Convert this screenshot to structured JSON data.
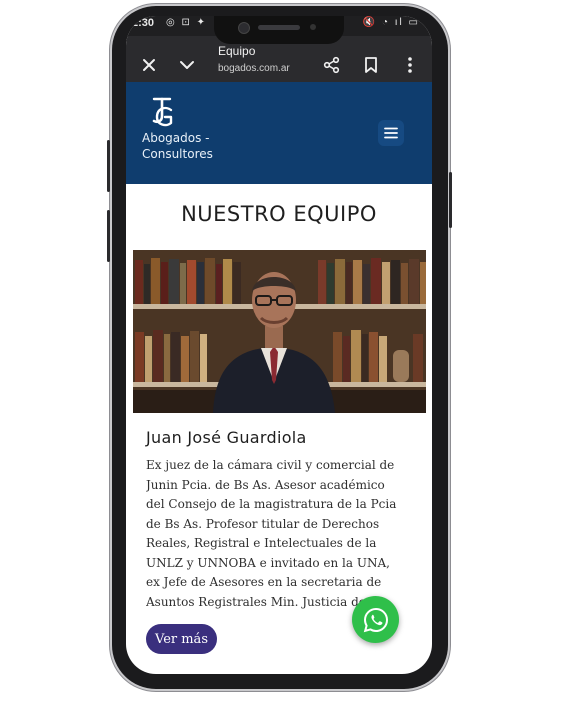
{
  "status_bar": {
    "time": "2:30",
    "left_icons": "◎ ⊡ ✦",
    "right_icons": "🔇 ◔ ıl ▭"
  },
  "browser": {
    "tab_title": "Equipo",
    "url": "bogados.com.ar",
    "close_icon": "close-icon",
    "chevron_icon": "chevron-down-icon",
    "share_icon": "share-icon",
    "bookmark_icon": "bookmark-icon",
    "more_icon": "more-vert-icon"
  },
  "site": {
    "logo_text_line1": "Abogados -",
    "logo_text_line2": "Consultores",
    "brand_color": "#0f3d6e",
    "menu_icon": "hamburger-icon"
  },
  "page": {
    "title": "NUESTRO EQUIPO"
  },
  "member": {
    "name": "Juan José Guardiola",
    "bio": "Ex juez de la cámara civil y comercial de Junin Pcia. de Bs As. Asesor académico del Consejo de la magistratura de la Pcia de Bs As. Profesor titular de Derechos Reales, Registral e Intelectuales de la UNLZ y UNNOBA e invitado en la UNA, ex Jefe de Asesores en la secretaria de Asuntos Registrales Min. Justicia de la Nación",
    "button_label": "Ver más",
    "button_color": "#3a2f7e"
  },
  "whatsapp": {
    "icon": "whatsapp-icon",
    "color": "#2fbf4a"
  }
}
